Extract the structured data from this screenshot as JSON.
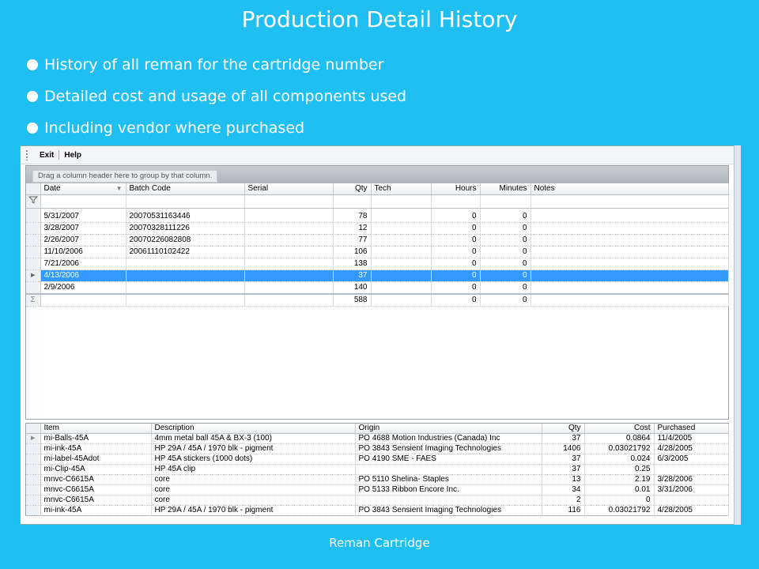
{
  "slide": {
    "title": "Production Detail History",
    "bullets": [
      "History of all reman for the cartridge number",
      "Detailed cost and usage of all components used",
      "Including vendor where purchased"
    ],
    "footer": "Reman Cartridge"
  },
  "menu": {
    "exit": "Exit",
    "help": "Help"
  },
  "history_grid": {
    "group_hint": "Drag a column header here to group by that column.",
    "columns": [
      "Date",
      "Batch Code",
      "Serial",
      "Qty",
      "Tech",
      "Hours",
      "Minutes",
      "Notes"
    ],
    "rows": [
      {
        "date": "5/31/2007",
        "batch": "20070531163446",
        "serial": "",
        "qty": "78",
        "tech": "",
        "hours": "0",
        "minutes": "0",
        "notes": ""
      },
      {
        "date": "3/28/2007",
        "batch": "20070328111226",
        "serial": "",
        "qty": "12",
        "tech": "",
        "hours": "0",
        "minutes": "0",
        "notes": ""
      },
      {
        "date": "2/26/2007",
        "batch": "20070226082808",
        "serial": "",
        "qty": "77",
        "tech": "",
        "hours": "0",
        "minutes": "0",
        "notes": ""
      },
      {
        "date": "11/10/2006",
        "batch": "20061110102422",
        "serial": "",
        "qty": "106",
        "tech": "",
        "hours": "0",
        "minutes": "0",
        "notes": ""
      },
      {
        "date": "7/21/2006",
        "batch": "",
        "serial": "",
        "qty": "138",
        "tech": "",
        "hours": "0",
        "minutes": "0",
        "notes": ""
      },
      {
        "date": "4/13/2006",
        "batch": "",
        "serial": "",
        "qty": "37",
        "tech": "",
        "hours": "0",
        "minutes": "0",
        "notes": ""
      },
      {
        "date": "2/9/2006",
        "batch": "",
        "serial": "",
        "qty": "140",
        "tech": "",
        "hours": "0",
        "minutes": "0",
        "notes": ""
      }
    ],
    "selected_row": 5,
    "summary": {
      "qty": "588",
      "hours": "0",
      "minutes": "0"
    }
  },
  "components_grid": {
    "columns": [
      "Item",
      "Description",
      "Origin",
      "Qty",
      "Cost",
      "Purchased"
    ],
    "rows": [
      {
        "item": "mi-Balls-45A",
        "description": "4mm metal ball 45A & BX-3 (100)",
        "origin": "PO 4688 Motion Industries (Canada) Inc",
        "qty": "37",
        "cost": "0.0864",
        "purchased": "11/4/2005"
      },
      {
        "item": "mi-ink-45A",
        "description": "HP 29A / 45A / 1970 blk - pigment",
        "origin": "PO 3843 Sensient Imaging Technologies",
        "qty": "1406",
        "cost": "0.03021792",
        "purchased": "4/28/2005"
      },
      {
        "item": "mi-label-45Adot",
        "description": "HP 45A stickers (1000 dots)",
        "origin": "PO 4190 SME - FAES",
        "qty": "37",
        "cost": "0.024",
        "purchased": "6/3/2005"
      },
      {
        "item": "mi-Clip-45A",
        "description": "HP 45A clip",
        "origin": "",
        "qty": "37",
        "cost": "0.25",
        "purchased": ""
      },
      {
        "item": "mnvc-C6615A",
        "description": "core",
        "origin": "PO 5110 Shelina- Staples",
        "qty": "13",
        "cost": "2.19",
        "purchased": "3/28/2006"
      },
      {
        "item": "mnvc-C6615A",
        "description": "core",
        "origin": "PO 5133 Ribbon Encore Inc.",
        "qty": "34",
        "cost": "0.01",
        "purchased": "3/31/2006"
      },
      {
        "item": "mnvc-C6615A",
        "description": "core",
        "origin": "",
        "qty": "2",
        "cost": "0",
        "purchased": ""
      },
      {
        "item": "mi-ink-45A",
        "description": "HP 29A / 45A / 1970 blk - pigment",
        "origin": "PO 3843 Sensient Imaging Technologies",
        "qty": "116",
        "cost": "0.03021792",
        "purchased": "4/28/2005"
      }
    ]
  },
  "icons": {
    "filter": "filter-icon",
    "sum": "sigma-icon",
    "row_pointer": "row-pointer-icon",
    "sort": "sort-arrow-icon"
  },
  "colors": {
    "background": "#1FBFF2",
    "selection": "#3399ff"
  }
}
